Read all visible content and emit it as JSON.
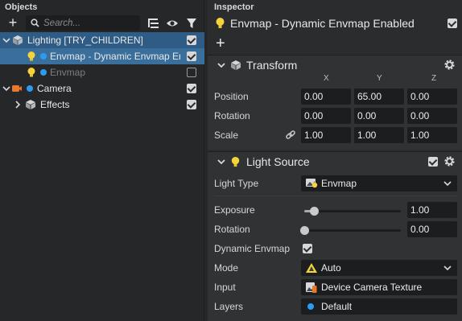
{
  "objects_panel": {
    "title": "Objects",
    "search_placeholder": "Search...",
    "tree": [
      {
        "label": "Lighting [TRY_CHILDREN]",
        "level": 0,
        "expanded": true,
        "icon": "group-cube-icon",
        "checked": true
      },
      {
        "label": "Envmap - Dynamic Envmap Ena",
        "level": 1,
        "icon": "light-bulb-icon",
        "checked": true,
        "selected": true
      },
      {
        "label": "Envmap",
        "level": 1,
        "icon": "light-bulb-icon",
        "checked": false,
        "dimmed": true
      },
      {
        "label": "Camera",
        "level": 0,
        "expanded": true,
        "icon": "camera-icon",
        "checked": true
      },
      {
        "label": "Effects",
        "level": 1,
        "expanded": false,
        "icon": "group-cube-icon",
        "checked": true
      }
    ]
  },
  "inspector": {
    "title": "Inspector",
    "object_name": "Envmap - Dynamic Envmap Enabled",
    "object_enabled": true,
    "transform": {
      "title": "Transform",
      "axes": [
        "X",
        "Y",
        "Z"
      ],
      "rows": [
        {
          "label": "Position",
          "values": [
            "0.00",
            "65.00",
            "0.00"
          ]
        },
        {
          "label": "Rotation",
          "values": [
            "0.00",
            "0.00",
            "0.00"
          ]
        },
        {
          "label": "Scale",
          "values": [
            "1.00",
            "1.00",
            "1.00"
          ]
        }
      ]
    },
    "light_source": {
      "title": "Light Source",
      "enabled": true,
      "light_type_label": "Light Type",
      "light_type_value": "Envmap",
      "exposure_label": "Exposure",
      "exposure_value": "1.00",
      "exposure_slider_fraction": 0.1,
      "rotation_label": "Rotation",
      "rotation_value": "0.00",
      "rotation_slider_fraction": 0.0,
      "dynamic_envmap_label": "Dynamic Envmap",
      "dynamic_envmap_checked": true,
      "mode_label": "Mode",
      "mode_value": "Auto",
      "input_label": "Input",
      "input_value": "Device Camera Texture",
      "layers_label": "Layers",
      "layers_value": "Default"
    }
  },
  "colors": {
    "selection": "#2e5c85",
    "accent_dot": "#2e9bf0",
    "bulb": "#f5d33b",
    "camera": "#e8782a"
  }
}
